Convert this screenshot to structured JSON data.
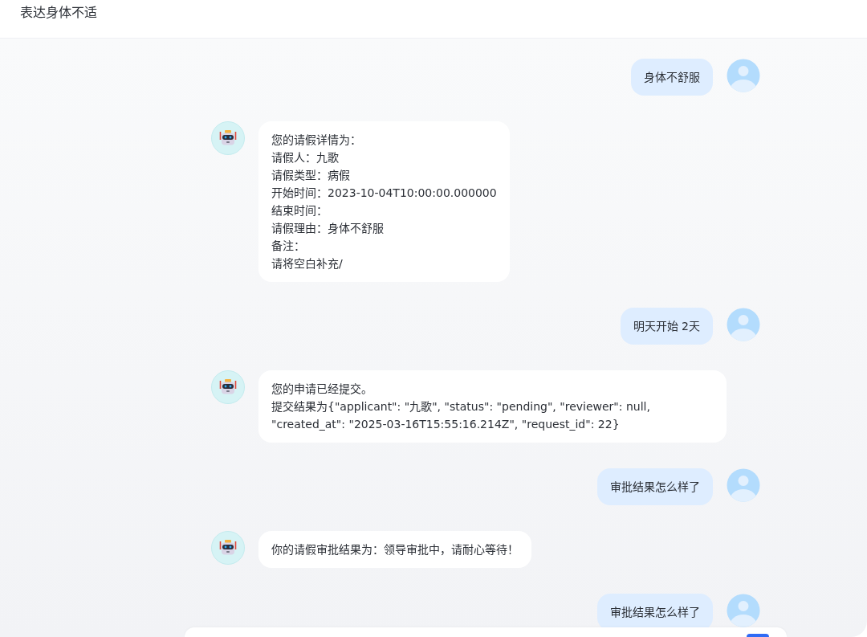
{
  "header": {
    "title": "表达身体不适"
  },
  "messages": [
    {
      "kind": "user",
      "lines": [
        "身体不舒服"
      ]
    },
    {
      "kind": "bot",
      "lines": [
        "您的请假详情为：",
        "请假人：九歌",
        "请假类型：病假",
        "开始时间：2023-10-04T10:00:00.000000",
        "结束时间：",
        "请假理由：身体不舒服",
        "备注：",
        "请将空白补充/"
      ]
    },
    {
      "kind": "user",
      "lines": [
        "明天开始 2天"
      ]
    },
    {
      "kind": "bot",
      "lines": [
        "您的申请已经提交。",
        "提交结果为{\"applicant\": \"九歌\", \"status\": \"pending\", \"reviewer\": null, \"created_at\": \"2025-03-16T15:55:16.214Z\", \"request_id\": 22}"
      ]
    },
    {
      "kind": "user",
      "lines": [
        "审批结果怎么样了"
      ]
    },
    {
      "kind": "bot",
      "lines": [
        "你的请假审批结果为：领导审批中，请耐心等待！"
      ]
    },
    {
      "kind": "user",
      "lines": [
        "审批结果怎么样了"
      ]
    }
  ]
}
